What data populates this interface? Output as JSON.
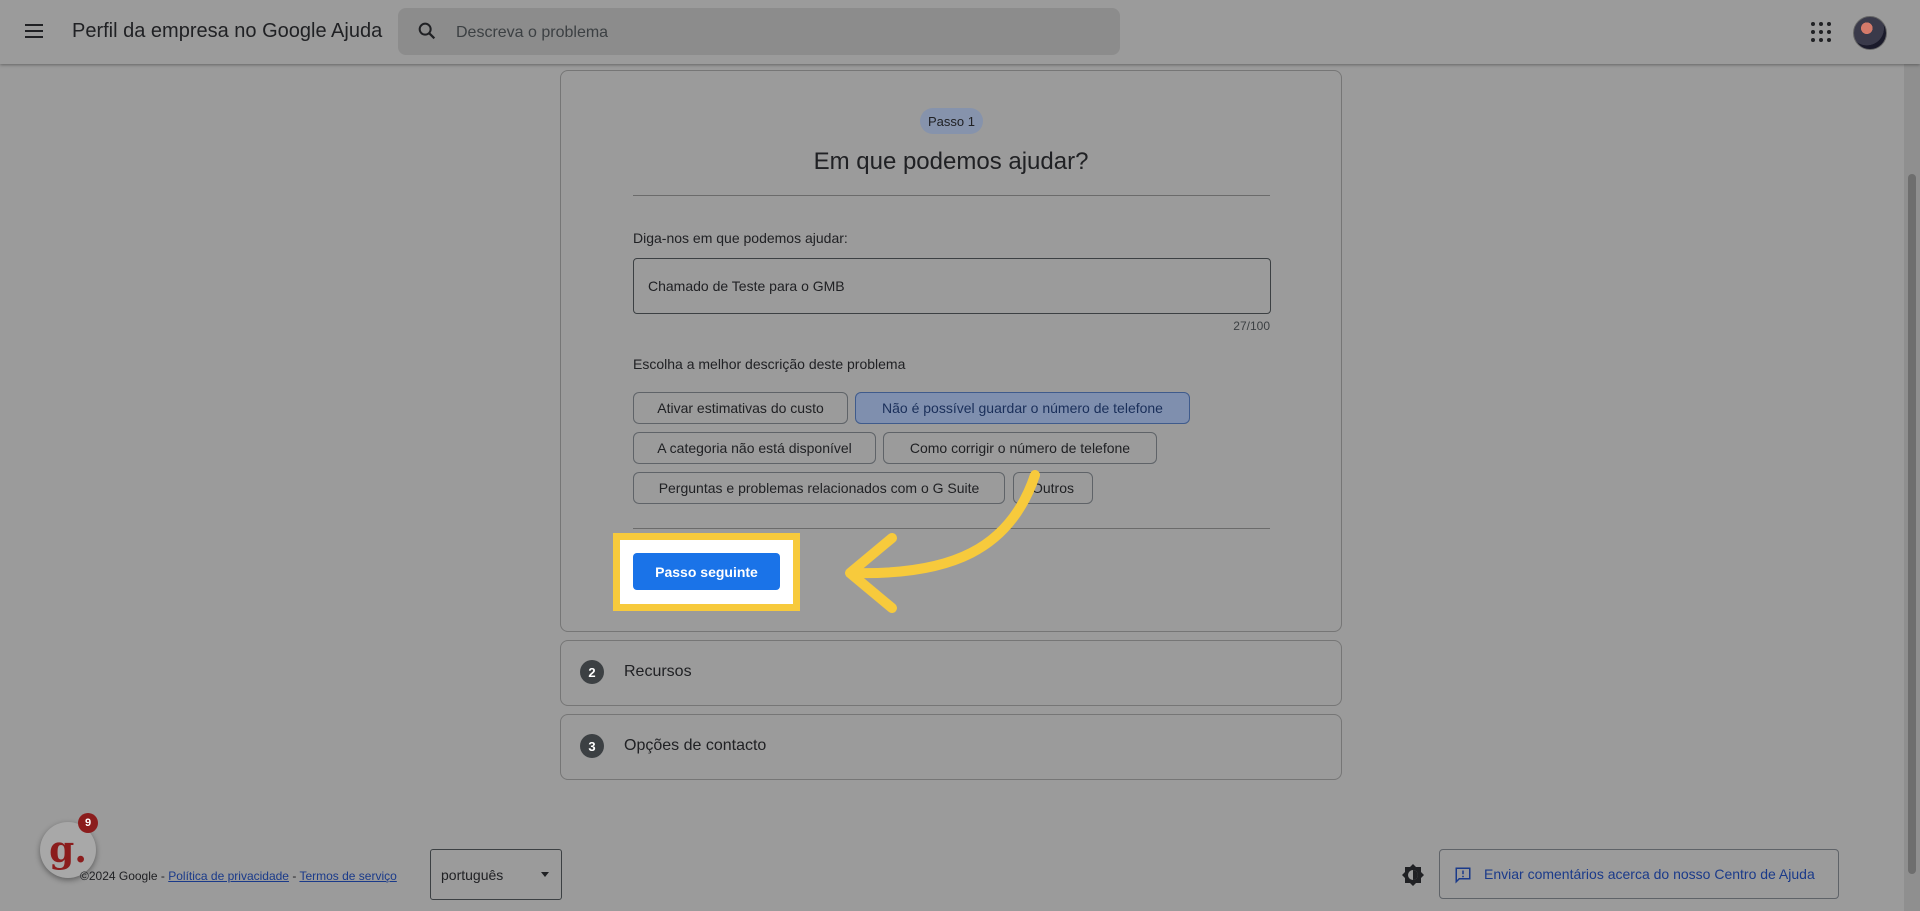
{
  "header": {
    "app_title": "Perfil da empresa no Google Ajuda",
    "search_placeholder": "Descreva o problema",
    "icons": [
      "menu-icon",
      "search-icon",
      "apps-icon",
      "avatar"
    ]
  },
  "step1": {
    "pill": "Passo 1",
    "heading": "Em que podemos ajudar?",
    "field_label": "Diga-nos em que podemos ajudar:",
    "field_value": "Chamado de Teste para o GMB",
    "counter": "27/100",
    "choice_label": "Escolha a melhor descrição deste problema",
    "chips": [
      {
        "label": "Ativar estimativas do custo",
        "selected": false
      },
      {
        "label": "Não é possível guardar o número de telefone",
        "selected": true
      },
      {
        "label": "A categoria não está disponível",
        "selected": false
      },
      {
        "label": "Como corrigir o número de telefone",
        "selected": false
      },
      {
        "label": "Perguntas e problemas relacionados com o G Suite",
        "selected": false
      },
      {
        "label": "Outros",
        "selected": false
      }
    ],
    "next_button": "Passo seguinte"
  },
  "step2": {
    "number": "2",
    "title": "Recursos"
  },
  "step3": {
    "number": "3",
    "title": "Opções de contacto"
  },
  "footer": {
    "badge_letter": "g.",
    "badge_count": "9",
    "copyright": "©2024 Google - ",
    "privacy_link": "Política de privacidade",
    "separator": " - ",
    "terms_link": "Termos de serviço",
    "language": "português",
    "feedback_button": "Enviar comentários acerca do nosso Centro de Ajuda"
  },
  "colors": {
    "accent": "#1a73e8",
    "highlight": "#f7ca3c",
    "overlay": "#9b9b9b"
  }
}
